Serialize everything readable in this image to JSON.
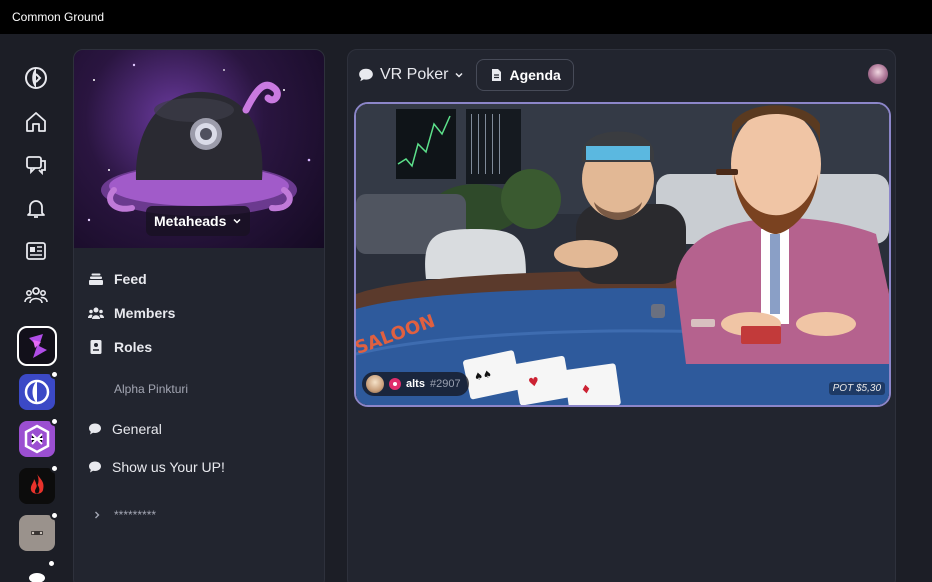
{
  "window": {
    "title": "Common Ground"
  },
  "rail": {
    "icons": [
      "app-logo-icon",
      "home-icon",
      "chat-icon",
      "bell-icon",
      "news-icon",
      "people-icon"
    ],
    "communities": [
      {
        "name": "metaheads-community",
        "active": true,
        "notify": false
      },
      {
        "name": "common-ground-community",
        "active": false,
        "notify": true
      },
      {
        "name": "hexagon-community",
        "active": false,
        "notify": true
      },
      {
        "name": "fire-community",
        "active": false,
        "notify": true
      },
      {
        "name": "gray-community",
        "active": false,
        "notify": true
      }
    ]
  },
  "community": {
    "name": "Metaheads",
    "nav": {
      "feed": "Feed",
      "members": "Members",
      "roles": "Roles"
    },
    "section_label": "Alpha Pinkturi",
    "channels": {
      "general": "General",
      "show_up": "Show us Your UP!"
    },
    "collapsed_group": "*********"
  },
  "main": {
    "channel_title": "VR Poker",
    "agenda_label": "Agenda",
    "video": {
      "user_name": "alts",
      "user_discriminator": "#2907",
      "pot_label": "POT $5,30"
    }
  },
  "colors": {
    "accent_border": "#8c86c9",
    "live_dot": "#e02e6c",
    "panel_bg": "#22252f",
    "app_bg": "#1c1e26"
  }
}
